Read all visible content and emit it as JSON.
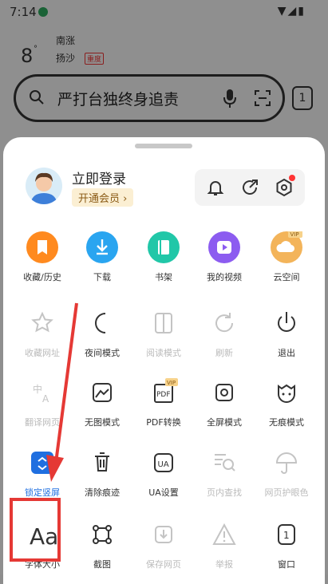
{
  "status": {
    "time": "7:14",
    "right": "▼◢▮"
  },
  "weather": {
    "temp": "8",
    "deg": "°",
    "wind": "南涨",
    "city": "扬沙",
    "badge": "重度"
  },
  "search": {
    "text": "严打台独终身追责"
  },
  "tab_count": "1",
  "sheet": {
    "login": "立即登录",
    "vip": "开通会员 ›"
  },
  "menu": [
    {
      "label": "收藏/历史",
      "icon": "bookmark-icon",
      "color": "#ff8a1f"
    },
    {
      "label": "下载",
      "icon": "download-icon",
      "color": "#2aa5f0"
    },
    {
      "label": "书架",
      "icon": "book-icon",
      "color": "#21c7a8"
    },
    {
      "label": "我的视频",
      "icon": "video-icon",
      "color": "#8c5cf0"
    },
    {
      "label": "云空间",
      "icon": "cloud-icon",
      "color": "#f3b45a"
    },
    {
      "label": "收藏网址",
      "icon": "star-icon",
      "disabled": true
    },
    {
      "label": "夜间模式",
      "icon": "moon-icon"
    },
    {
      "label": "阅读模式",
      "icon": "reader-icon",
      "disabled": true
    },
    {
      "label": "刷新",
      "icon": "refresh-icon",
      "disabled": true
    },
    {
      "label": "退出",
      "icon": "power-icon"
    },
    {
      "label": "翻译网页",
      "icon": "translate-icon",
      "disabled": true
    },
    {
      "label": "无图模式",
      "icon": "no-image-icon"
    },
    {
      "label": "PDF转换",
      "icon": "pdf-icon"
    },
    {
      "label": "全屏模式",
      "icon": "fullscreen-icon"
    },
    {
      "label": "无痕模式",
      "icon": "incognito-icon"
    },
    {
      "label": "锁定竖屏",
      "icon": "lock-portrait-icon",
      "active": true
    },
    {
      "label": "清除痕迹",
      "icon": "trash-icon"
    },
    {
      "label": "UA设置",
      "icon": "ua-icon"
    },
    {
      "label": "页内查找",
      "icon": "find-in-page-icon",
      "disabled": true
    },
    {
      "label": "网页护眼色",
      "icon": "umbrella-icon",
      "disabled": true
    },
    {
      "label": "字体大小",
      "icon": "font-size-icon"
    },
    {
      "label": "截图",
      "icon": "screenshot-icon"
    },
    {
      "label": "保存网页",
      "icon": "save-page-icon",
      "disabled": true
    },
    {
      "label": "举报",
      "icon": "report-icon",
      "disabled": true
    },
    {
      "label": "窗口",
      "icon": "window-icon",
      "badge": "1"
    }
  ]
}
